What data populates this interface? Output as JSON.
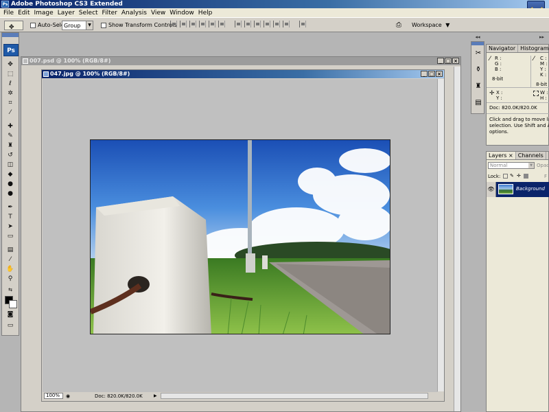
{
  "app": {
    "title": "Adobe Photoshop CS3 Extended",
    "logo": "Ps",
    "logo_mini": "Ps"
  },
  "menu": [
    "File",
    "Edit",
    "Image",
    "Layer",
    "Select",
    "Filter",
    "Analysis",
    "View",
    "Window",
    "Help"
  ],
  "options": {
    "auto_select_label": "Auto-Select:",
    "auto_select_value": "Group",
    "show_transform_label": "Show Transform Controls",
    "workspace_label": "Workspace"
  },
  "documents": {
    "back": {
      "title": "007.psd @ 100% (RGB/8#)"
    },
    "front": {
      "title": "047.jpg @ 100% (RGB/8#)",
      "zoom": "100%",
      "doc_info": "Doc: 820.0K/820.0K"
    }
  },
  "info_panel": {
    "tabs": [
      "Navigator",
      "Histogram",
      "In"
    ],
    "rgb_labels": [
      "R :",
      "G :",
      "B :"
    ],
    "cmyk_labels": [
      "C :",
      "M :",
      "Y :",
      "K :"
    ],
    "bit_left": "8-bit",
    "bit_right": "8-bit",
    "xy_labels": [
      "X :",
      "Y :"
    ],
    "wh_labels": [
      "W :",
      "H :"
    ],
    "doc_info": "Doc: 820.0K/820.0K",
    "hint": "Click and drag to move layer or selection. Use Shift and Alt for options."
  },
  "layers_panel": {
    "tabs": [
      "Layers ×",
      "Channels"
    ],
    "blend_mode": "Normal",
    "opacity_label": "Opaci",
    "lock_label": "Lock:",
    "fill_label": "F",
    "layer_name": "Background"
  },
  "colors": {
    "title_dark": "#0a246a",
    "title_light": "#a6caf0",
    "inactive_title": "#8c8c8c",
    "accent": "#1f5aa8"
  }
}
